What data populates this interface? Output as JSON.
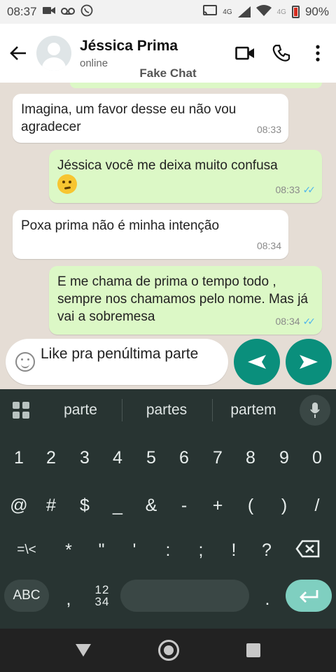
{
  "status_bar": {
    "time": "08:37",
    "icons_left": [
      "video-camera-icon",
      "voicemail-icon",
      "whatsapp-icon"
    ],
    "icons_right": [
      "cast-icon",
      "signal-4g-icon",
      "wifi-icon",
      "signal-4g-icon",
      "battery-icon"
    ],
    "net1": "4G",
    "net2": "4G",
    "battery": "90%"
  },
  "header": {
    "contact_name": "Jéssica Prima",
    "contact_status": "online",
    "watermark": "Fake Chat",
    "actions": [
      "video-call-icon",
      "phone-icon",
      "more-vert-icon"
    ]
  },
  "messages": [
    {
      "dir": "in",
      "text": "Imagina, um favor desse eu não vou agradecer",
      "time": "08:33"
    },
    {
      "dir": "out",
      "text": "Jéssica você me deixa muito confusa",
      "emoji": "thinking-face-emoji",
      "time": "08:33",
      "ticks": "✓✓"
    },
    {
      "dir": "in",
      "text": "Poxa prima não é minha intenção",
      "time": "08:34"
    },
    {
      "dir": "out",
      "text": "E me chama de prima o tempo todo , sempre nos chamamos pelo nome. Mas já vai a sobremesa",
      "time": "08:34",
      "ticks": "✓✓"
    }
  ],
  "input": {
    "value": "Like pra penúltima parte"
  },
  "keyboard": {
    "suggestions": [
      "parte",
      "partes",
      "partem"
    ],
    "row1": [
      "1",
      "2",
      "3",
      "4",
      "5",
      "6",
      "7",
      "8",
      "9",
      "0"
    ],
    "row2": [
      "@",
      "#",
      "$",
      "_",
      "&",
      "-",
      "+",
      "(",
      ")",
      "/"
    ],
    "row3": [
      "=\\<",
      "*",
      "\"",
      "'",
      ":",
      ";",
      "!",
      "?"
    ],
    "abc": "ABC",
    "comma": ",",
    "num_top": "12",
    "num_bottom": "34",
    "period": "."
  },
  "colors": {
    "accent": "#0a8f7c",
    "outgoing_bubble": "#dcf8c6",
    "chat_bg": "#e5ddd5",
    "ticks": "#4fb6ec"
  }
}
